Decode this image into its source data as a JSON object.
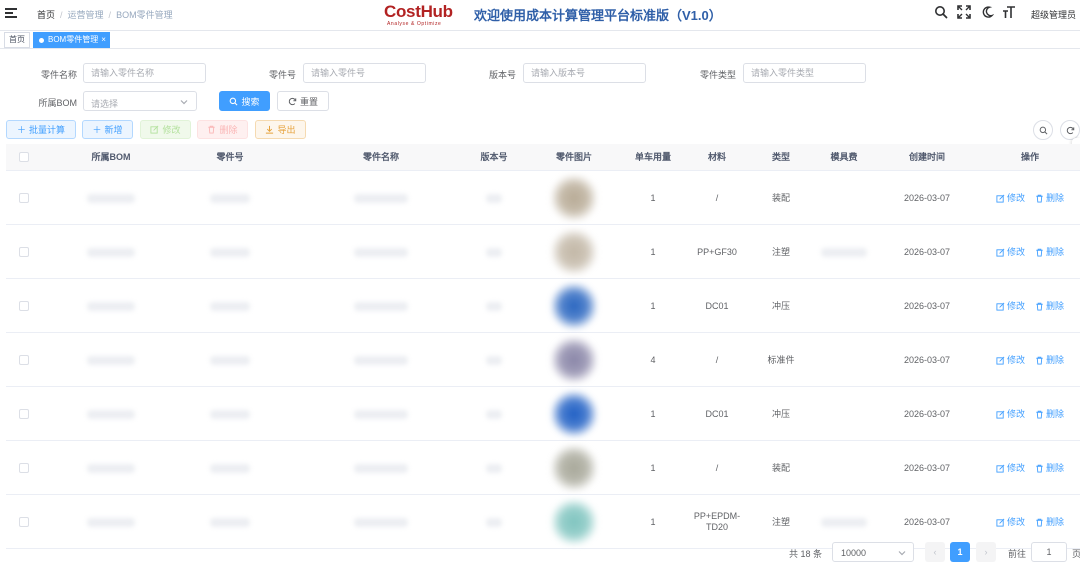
{
  "header": {
    "breadcrumb": [
      "首页",
      "运营管理",
      "BOM零件管理"
    ],
    "breadcrumb_sep": "/",
    "logo_text": "CostHub",
    "logo_tagline": "Analyse & Optimize",
    "app_title": "欢迎使用成本计算管理平台标准版（V1.0）",
    "icons": [
      "search-icon",
      "fullscreen-icon",
      "theme-moon-icon",
      "font-size-icon"
    ],
    "user_name": "超级管理员"
  },
  "tags": {
    "home": "首页",
    "active": "BOM零件管理",
    "close_glyph": "×"
  },
  "search_form": {
    "part_name_label": "零件名称",
    "part_name_placeholder": "请输入零件名称",
    "part_no_label": "零件号",
    "part_no_placeholder": "请输入零件号",
    "version_label": "版本号",
    "version_placeholder": "请输入版本号",
    "part_type_label": "零件类型",
    "part_type_placeholder": "请输入零件类型",
    "bom_label": "所属BOM",
    "bom_placeholder": "请选择",
    "search_button": "搜索",
    "reset_button": "重置"
  },
  "toolbar": {
    "batch_calc": "批量计算",
    "add": "新增",
    "edit": "修改",
    "delete": "删除",
    "export": "导出"
  },
  "table": {
    "columns": [
      "所属BOM",
      "零件号",
      "零件名称",
      "版本号",
      "零件图片",
      "单车用量",
      "材料",
      "类型",
      "模具费",
      "创建时间",
      "操作"
    ],
    "edit_label": "修改",
    "delete_label": "删除",
    "rows": [
      {
        "qty": "1",
        "material": "/",
        "type": "装配",
        "created": "2026-03-07",
        "tooling_blurred": false,
        "img_color": "#b8ab96"
      },
      {
        "qty": "1",
        "material": "PP+GF30",
        "type": "注塑",
        "created": "2026-03-07",
        "tooling_blurred": true,
        "img_color": "#c2b7a6"
      },
      {
        "qty": "1",
        "material": "DC01",
        "type": "冲压",
        "created": "2026-03-07",
        "tooling_blurred": false,
        "img_color": "#2a66c0"
      },
      {
        "qty": "4",
        "material": "/",
        "type": "标准件",
        "created": "2026-03-07",
        "tooling_blurred": false,
        "img_color": "#8a86a8"
      },
      {
        "qty": "1",
        "material": "DC01",
        "type": "冲压",
        "created": "2026-03-07",
        "tooling_blurred": false,
        "img_color": "#1f5fc4"
      },
      {
        "qty": "1",
        "material": "/",
        "type": "装配",
        "created": "2026-03-07",
        "tooling_blurred": false,
        "img_color": "#a8a89a"
      },
      {
        "qty": "1",
        "material": "PP+EPDM-TD20",
        "type": "注塑",
        "created": "2026-03-07",
        "tooling_blurred": true,
        "img_color": "#7fc4bf"
      }
    ]
  },
  "pagination": {
    "total_text": "共 18 条",
    "page_size": "10000",
    "current_page": "1",
    "prev_glyph": "‹",
    "next_glyph": "›",
    "goto_label": "前往",
    "goto_value": "1",
    "unit": "页"
  }
}
